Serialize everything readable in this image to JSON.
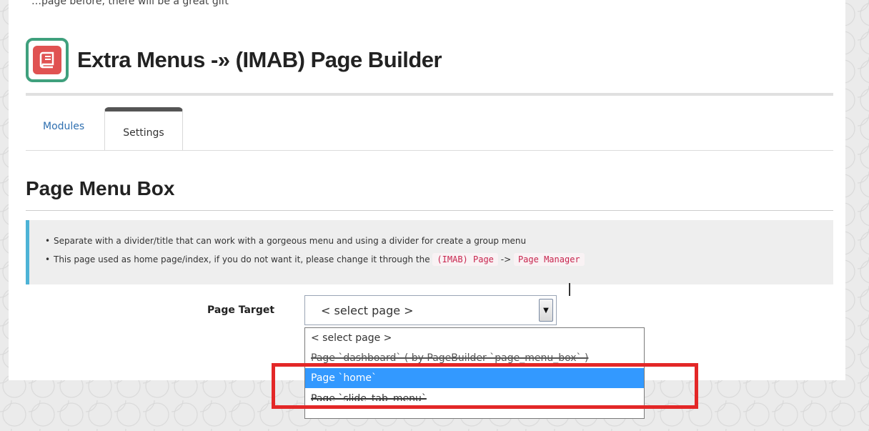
{
  "top_caption": "…page before, there will be a great gift",
  "header": {
    "logo_icon": "book-icon",
    "title": "Extra Menus -» (IMAB) Page Builder"
  },
  "tabs": [
    {
      "label": "Modules",
      "active": false
    },
    {
      "label": "Settings",
      "active": true
    }
  ],
  "section": {
    "title": "Page Menu Box"
  },
  "notice": {
    "line1": "Separate with a divider/title that can work with a gorgeous menu and using a divider for create a group menu",
    "line2_prefix": "This page used as home page/index, if you do not want it, please change it through the",
    "line2_code1": "(IMAB) Page",
    "line2_arrow": "->",
    "line2_code2": "Page Manager",
    "accent_color": "#4db3d6"
  },
  "form": {
    "page_target_label": "Page Target",
    "page_target_value": "< select page >",
    "options": [
      "< select page >",
      "Page `dashboard` ( by PageBuilder `page_menu_box` )",
      "Page `home`",
      "Page `slide_tab_menu`"
    ],
    "selected_option_index": 2
  },
  "colors": {
    "logo_border": "#3fa07d",
    "logo_fill": "#e05252",
    "selection": "#3399ff",
    "annotation_box": "#e32727"
  }
}
